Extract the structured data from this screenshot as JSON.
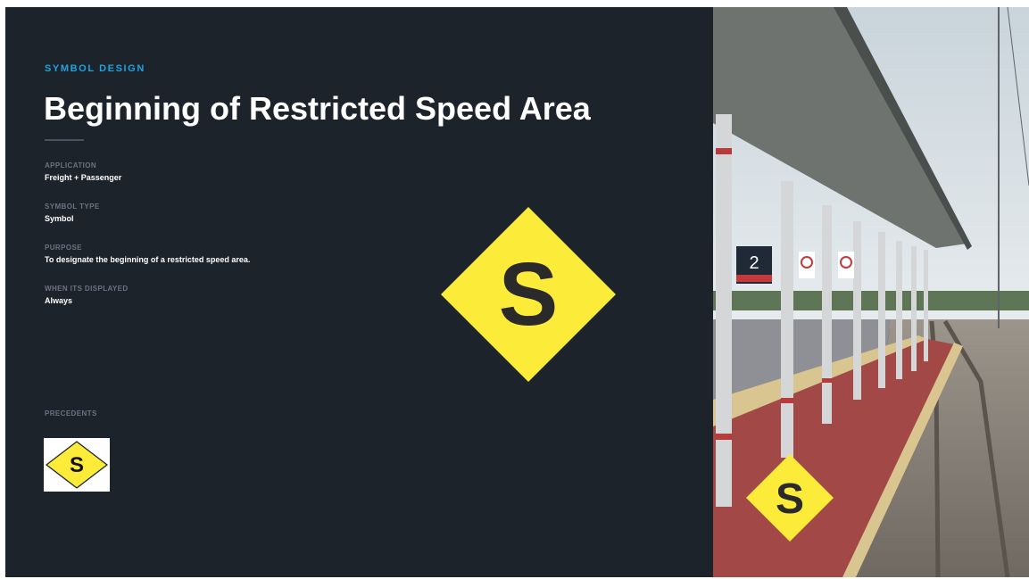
{
  "header": {
    "eyebrow": "SYMBOL DESIGN",
    "title": "Beginning of Restricted Speed Area"
  },
  "fields": [
    {
      "label": "APPLICATION",
      "value": "Freight + Passenger"
    },
    {
      "label": "SYMBOL TYPE",
      "value": "Symbol"
    },
    {
      "label": "PURPOSE",
      "value": "To designate the beginning of a restricted speed area."
    },
    {
      "label": "WHEN ITS DISPLAYED",
      "value": "Always"
    }
  ],
  "precedents": {
    "label": "PRECEDENTS",
    "symbol_letter": "S"
  },
  "sign": {
    "letter": "S",
    "fill_color": "#fcec39",
    "letter_color": "#2a2a2a"
  },
  "photo": {
    "platform_number": "2",
    "sign_letter": "S"
  },
  "colors": {
    "background": "#1d232b",
    "accent": "#1fa3dd"
  }
}
